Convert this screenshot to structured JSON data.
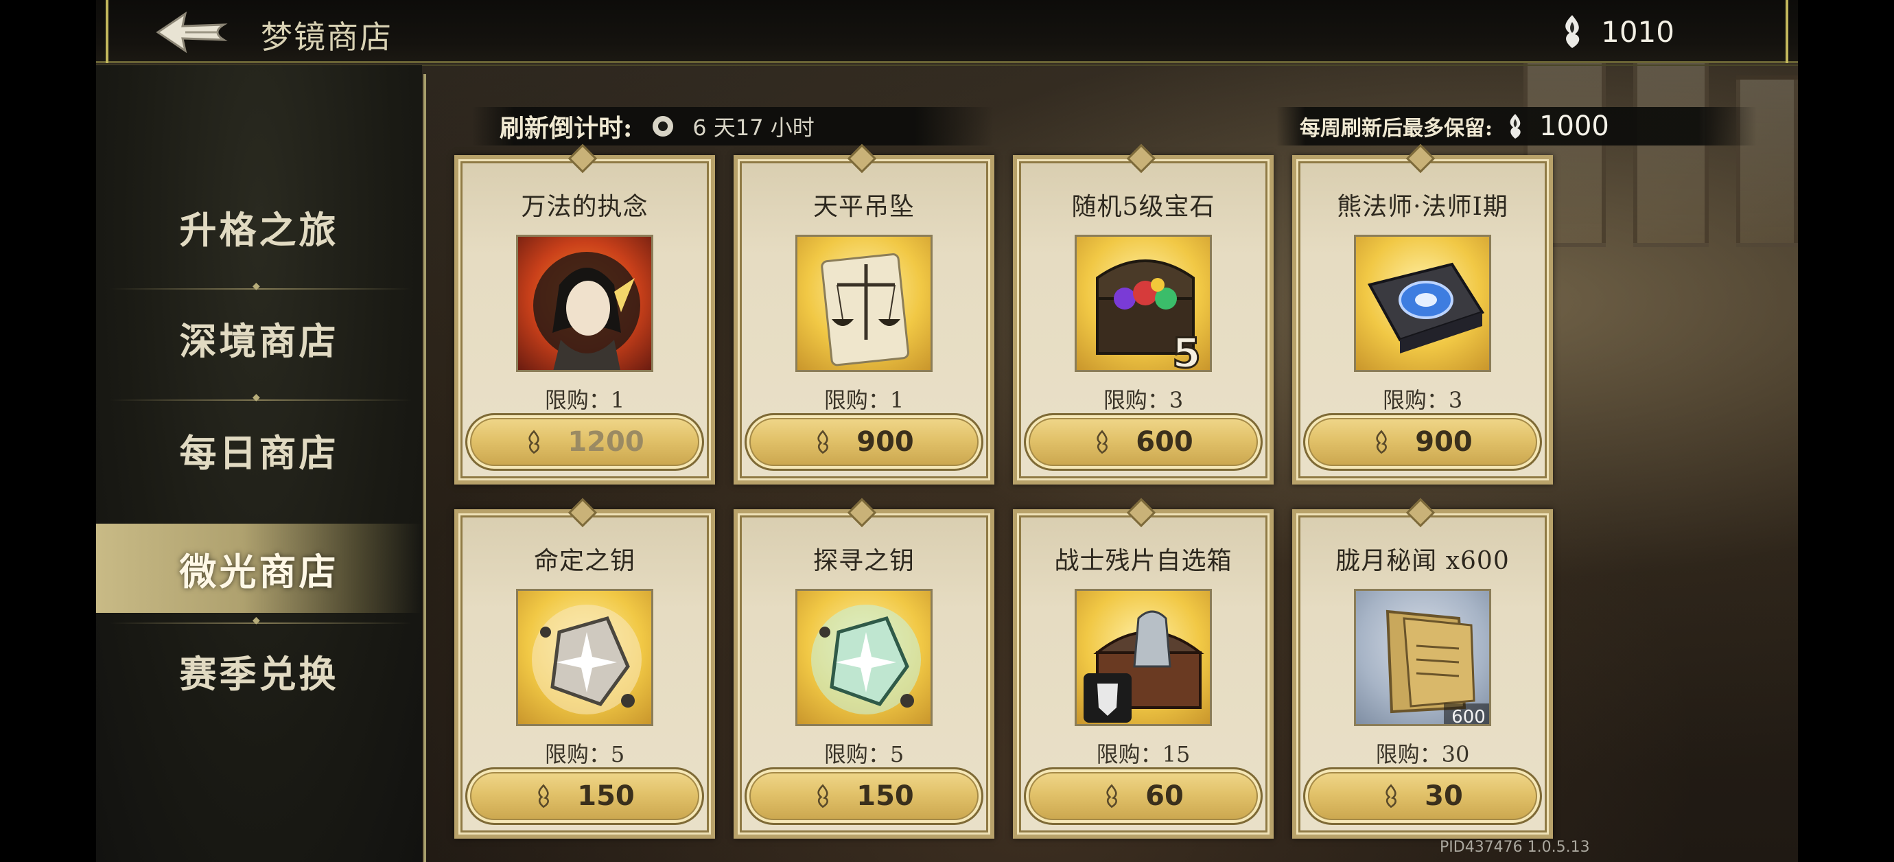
{
  "header": {
    "title": "梦镜商店",
    "currency_amount": "1010"
  },
  "sidebar": {
    "items": [
      {
        "label": "升格之旅",
        "active": false
      },
      {
        "label": "深境商店",
        "active": false
      },
      {
        "label": "每日商店",
        "active": false
      },
      {
        "label": "微光商店",
        "active": true
      },
      {
        "label": "赛季兑换",
        "active": false
      }
    ]
  },
  "info": {
    "refresh_label": "刷新倒计时:",
    "refresh_time": "6 天17 小时",
    "weekly_label": "每周刷新后最多保留:",
    "weekly_amount": "1000"
  },
  "cards": [
    {
      "name": "万法的执念",
      "limit": "限购：1",
      "price": "1200",
      "icon": "character-portrait-icon",
      "disabled": true
    },
    {
      "name": "天平吊坠",
      "limit": "限购：1",
      "price": "900",
      "icon": "balance-scale-pendant-icon",
      "disabled": false
    },
    {
      "name": "随机5级宝石",
      "limit": "限购：3",
      "price": "600",
      "icon": "gem-chest-icon",
      "disabled": false
    },
    {
      "name": "熊法师·法师I期",
      "limit": "限购：3",
      "price": "900",
      "icon": "spellbook-icon",
      "disabled": false
    },
    {
      "name": "命定之钥",
      "limit": "限购：5",
      "price": "150",
      "icon": "fate-key-crystal-icon",
      "disabled": false
    },
    {
      "name": "探寻之钥",
      "limit": "限购：5",
      "price": "150",
      "icon": "search-key-crystal-icon",
      "disabled": false
    },
    {
      "name": "战士残片自选箱",
      "limit": "限购：15",
      "price": "60",
      "icon": "warrior-fragment-chest-icon",
      "disabled": false
    },
    {
      "name": "胧月秘闻 x600",
      "limit": "限购：30",
      "price": "30",
      "icon": "scroll-document-icon",
      "badge": "600",
      "disabled": false
    }
  ],
  "chest_badge": "5",
  "version": "PID437476  1.0.5.13",
  "colors": {
    "accent_gold": "#e2c26a",
    "frame_gold": "#b8a26a",
    "card_bg": "#e6dcc2"
  }
}
